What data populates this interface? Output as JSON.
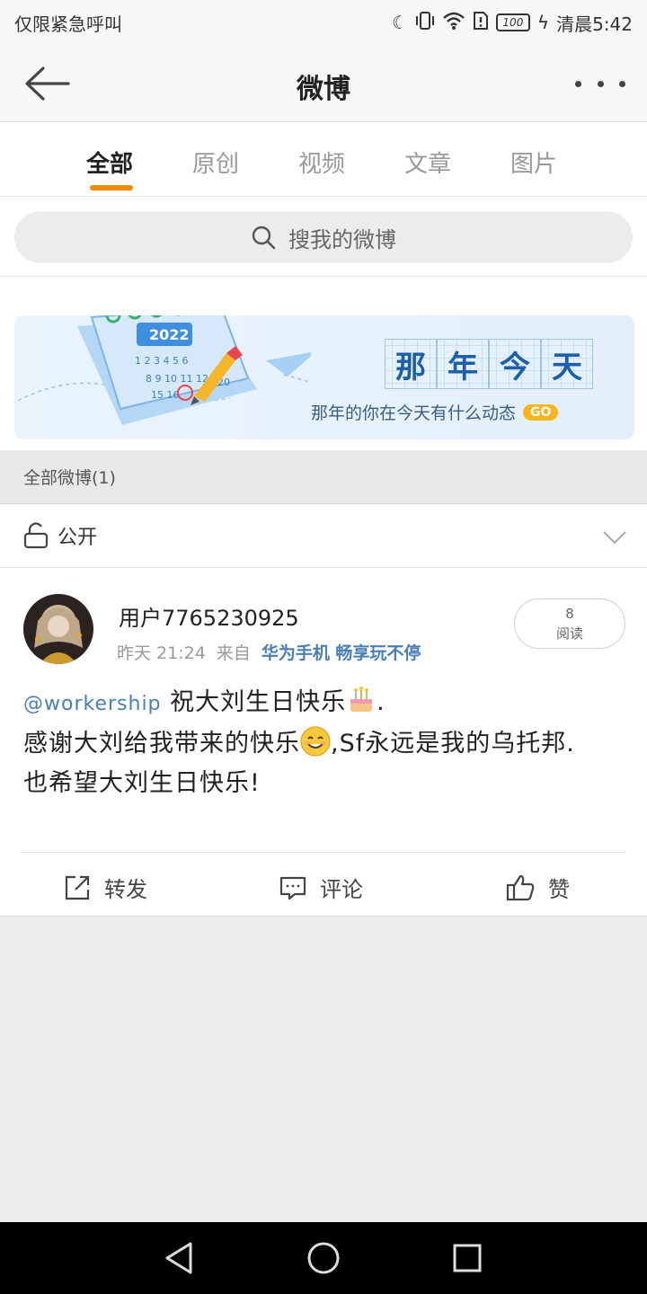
{
  "status_bar": {
    "carrier": "仅限紧急呼叫",
    "battery": "100",
    "time": "清晨5:42"
  },
  "header": {
    "title": "微博"
  },
  "tabs": [
    {
      "label": "全部"
    },
    {
      "label": "原创"
    },
    {
      "label": "视频"
    },
    {
      "label": "文章"
    },
    {
      "label": "图片"
    }
  ],
  "search": {
    "placeholder": "搜我的微博"
  },
  "banner": {
    "title_chars": [
      "那",
      "年",
      "今",
      "天"
    ],
    "subtitle": "那年的你在今天有什么动态",
    "go_label": "GO",
    "calendar_year": "2022"
  },
  "section": {
    "label": "全部微博(1)"
  },
  "privacy": {
    "label": "公开"
  },
  "post": {
    "username": "用户7765230925",
    "time": "昨天 21:24",
    "from_label": "来自",
    "source": "华为手机 畅享玩不停",
    "read_count": "8",
    "read_label": "阅读",
    "mention": "@workership",
    "line1_text": " 祝大刘生日快乐",
    "line1_end": ".",
    "line2_text": "感谢大刘给我带来的快乐",
    "line2_end": ",Sf永远是我的乌托邦.",
    "line3_text": "也希望大刘生日快乐!"
  },
  "actions": {
    "repost": "转发",
    "comment": "评论",
    "like": "赞"
  },
  "colors": {
    "accent": "#f08c0a",
    "link": "#4a7fb6",
    "banner_text": "#1d5fa8"
  }
}
